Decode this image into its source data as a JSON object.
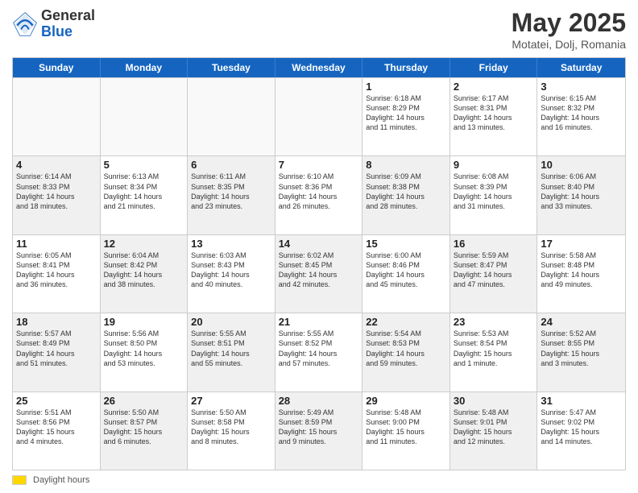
{
  "header": {
    "logo_general": "General",
    "logo_blue": "Blue",
    "title": "May 2025",
    "location": "Motatei, Dolj, Romania"
  },
  "weekdays": [
    "Sunday",
    "Monday",
    "Tuesday",
    "Wednesday",
    "Thursday",
    "Friday",
    "Saturday"
  ],
  "footer": {
    "label": "Daylight hours"
  },
  "weeks": [
    [
      {
        "day": "",
        "detail": "",
        "empty": true
      },
      {
        "day": "",
        "detail": "",
        "empty": true
      },
      {
        "day": "",
        "detail": "",
        "empty": true
      },
      {
        "day": "",
        "detail": "",
        "empty": true
      },
      {
        "day": "1",
        "detail": "Sunrise: 6:18 AM\nSunset: 8:29 PM\nDaylight: 14 hours\nand 11 minutes."
      },
      {
        "day": "2",
        "detail": "Sunrise: 6:17 AM\nSunset: 8:31 PM\nDaylight: 14 hours\nand 13 minutes."
      },
      {
        "day": "3",
        "detail": "Sunrise: 6:15 AM\nSunset: 8:32 PM\nDaylight: 14 hours\nand 16 minutes."
      }
    ],
    [
      {
        "day": "4",
        "detail": "Sunrise: 6:14 AM\nSunset: 8:33 PM\nDaylight: 14 hours\nand 18 minutes.",
        "shaded": true
      },
      {
        "day": "5",
        "detail": "Sunrise: 6:13 AM\nSunset: 8:34 PM\nDaylight: 14 hours\nand 21 minutes."
      },
      {
        "day": "6",
        "detail": "Sunrise: 6:11 AM\nSunset: 8:35 PM\nDaylight: 14 hours\nand 23 minutes.",
        "shaded": true
      },
      {
        "day": "7",
        "detail": "Sunrise: 6:10 AM\nSunset: 8:36 PM\nDaylight: 14 hours\nand 26 minutes."
      },
      {
        "day": "8",
        "detail": "Sunrise: 6:09 AM\nSunset: 8:38 PM\nDaylight: 14 hours\nand 28 minutes.",
        "shaded": true
      },
      {
        "day": "9",
        "detail": "Sunrise: 6:08 AM\nSunset: 8:39 PM\nDaylight: 14 hours\nand 31 minutes."
      },
      {
        "day": "10",
        "detail": "Sunrise: 6:06 AM\nSunset: 8:40 PM\nDaylight: 14 hours\nand 33 minutes.",
        "shaded": true
      }
    ],
    [
      {
        "day": "11",
        "detail": "Sunrise: 6:05 AM\nSunset: 8:41 PM\nDaylight: 14 hours\nand 36 minutes."
      },
      {
        "day": "12",
        "detail": "Sunrise: 6:04 AM\nSunset: 8:42 PM\nDaylight: 14 hours\nand 38 minutes.",
        "shaded": true
      },
      {
        "day": "13",
        "detail": "Sunrise: 6:03 AM\nSunset: 8:43 PM\nDaylight: 14 hours\nand 40 minutes."
      },
      {
        "day": "14",
        "detail": "Sunrise: 6:02 AM\nSunset: 8:45 PM\nDaylight: 14 hours\nand 42 minutes.",
        "shaded": true
      },
      {
        "day": "15",
        "detail": "Sunrise: 6:00 AM\nSunset: 8:46 PM\nDaylight: 14 hours\nand 45 minutes."
      },
      {
        "day": "16",
        "detail": "Sunrise: 5:59 AM\nSunset: 8:47 PM\nDaylight: 14 hours\nand 47 minutes.",
        "shaded": true
      },
      {
        "day": "17",
        "detail": "Sunrise: 5:58 AM\nSunset: 8:48 PM\nDaylight: 14 hours\nand 49 minutes."
      }
    ],
    [
      {
        "day": "18",
        "detail": "Sunrise: 5:57 AM\nSunset: 8:49 PM\nDaylight: 14 hours\nand 51 minutes.",
        "shaded": true
      },
      {
        "day": "19",
        "detail": "Sunrise: 5:56 AM\nSunset: 8:50 PM\nDaylight: 14 hours\nand 53 minutes."
      },
      {
        "day": "20",
        "detail": "Sunrise: 5:55 AM\nSunset: 8:51 PM\nDaylight: 14 hours\nand 55 minutes.",
        "shaded": true
      },
      {
        "day": "21",
        "detail": "Sunrise: 5:55 AM\nSunset: 8:52 PM\nDaylight: 14 hours\nand 57 minutes."
      },
      {
        "day": "22",
        "detail": "Sunrise: 5:54 AM\nSunset: 8:53 PM\nDaylight: 14 hours\nand 59 minutes.",
        "shaded": true
      },
      {
        "day": "23",
        "detail": "Sunrise: 5:53 AM\nSunset: 8:54 PM\nDaylight: 15 hours\nand 1 minute."
      },
      {
        "day": "24",
        "detail": "Sunrise: 5:52 AM\nSunset: 8:55 PM\nDaylight: 15 hours\nand 3 minutes.",
        "shaded": true
      }
    ],
    [
      {
        "day": "25",
        "detail": "Sunrise: 5:51 AM\nSunset: 8:56 PM\nDaylight: 15 hours\nand 4 minutes."
      },
      {
        "day": "26",
        "detail": "Sunrise: 5:50 AM\nSunset: 8:57 PM\nDaylight: 15 hours\nand 6 minutes.",
        "shaded": true
      },
      {
        "day": "27",
        "detail": "Sunrise: 5:50 AM\nSunset: 8:58 PM\nDaylight: 15 hours\nand 8 minutes."
      },
      {
        "day": "28",
        "detail": "Sunrise: 5:49 AM\nSunset: 8:59 PM\nDaylight: 15 hours\nand 9 minutes.",
        "shaded": true
      },
      {
        "day": "29",
        "detail": "Sunrise: 5:48 AM\nSunset: 9:00 PM\nDaylight: 15 hours\nand 11 minutes."
      },
      {
        "day": "30",
        "detail": "Sunrise: 5:48 AM\nSunset: 9:01 PM\nDaylight: 15 hours\nand 12 minutes.",
        "shaded": true
      },
      {
        "day": "31",
        "detail": "Sunrise: 5:47 AM\nSunset: 9:02 PM\nDaylight: 15 hours\nand 14 minutes."
      }
    ]
  ]
}
